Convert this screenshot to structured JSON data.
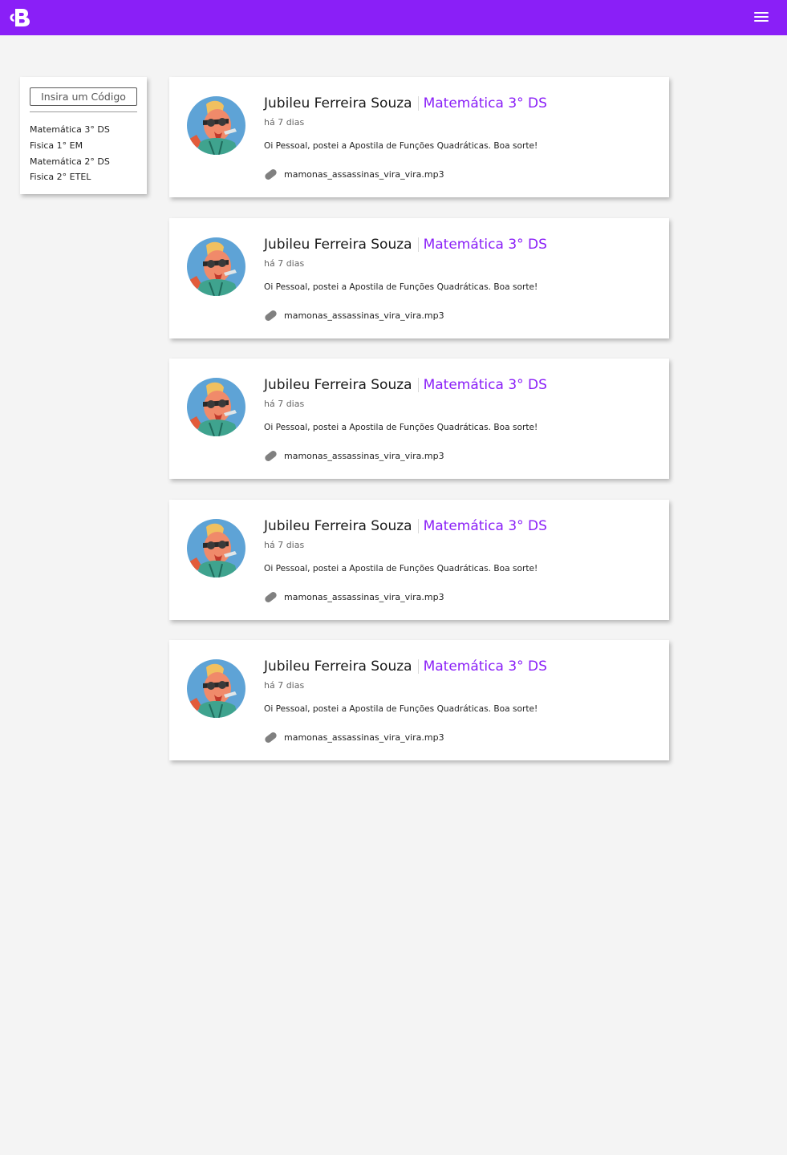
{
  "app": {
    "logo_icon": "brand-b-logo-icon",
    "menu_icon": "hamburger-menu-icon",
    "accent_color": "#8a1ff7"
  },
  "sidebar": {
    "code_placeholder": "Insira um Código",
    "classes": [
      {
        "label": "Matemática 3° DS"
      },
      {
        "label": "Fisica 1° EM"
      },
      {
        "label": "Matemática 2° DS"
      },
      {
        "label": "Fisica 2° ETEL"
      }
    ]
  },
  "feed": {
    "posts": [
      {
        "author": "Jubileu Ferreira Souza",
        "class_name": "Matemática 3° DS",
        "time": "há 7 dias",
        "message": "Oi Pessoal, postei a  Apostila de Funções Quadráticas. Boa sorte!",
        "attachment": "mamonas_assassinas_vira_vira.mp3"
      },
      {
        "author": "Jubileu Ferreira Souza",
        "class_name": "Matemática 3° DS",
        "time": "há 7 dias",
        "message": "Oi Pessoal, postei a  Apostila de Funções Quadráticas. Boa sorte!",
        "attachment": "mamonas_assassinas_vira_vira.mp3"
      },
      {
        "author": "Jubileu Ferreira Souza",
        "class_name": "Matemática 3° DS",
        "time": "há 7 dias",
        "message": "Oi Pessoal, postei a  Apostila de Funções Quadráticas. Boa sorte!",
        "attachment": "mamonas_assassinas_vira_vira.mp3"
      },
      {
        "author": "Jubileu Ferreira Souza",
        "class_name": "Matemática 3° DS",
        "time": "há 7 dias",
        "message": "Oi Pessoal, postei a  Apostila de Funções Quadráticas. Boa sorte!",
        "attachment": "mamonas_assassinas_vira_vira.mp3"
      },
      {
        "author": "Jubileu Ferreira Souza",
        "class_name": "Matemática 3° DS",
        "time": "há 7 dias",
        "message": "Oi Pessoal, postei a  Apostila de Funções Quadráticas. Boa sorte!",
        "attachment": "mamonas_assassinas_vira_vira.mp3"
      }
    ]
  }
}
